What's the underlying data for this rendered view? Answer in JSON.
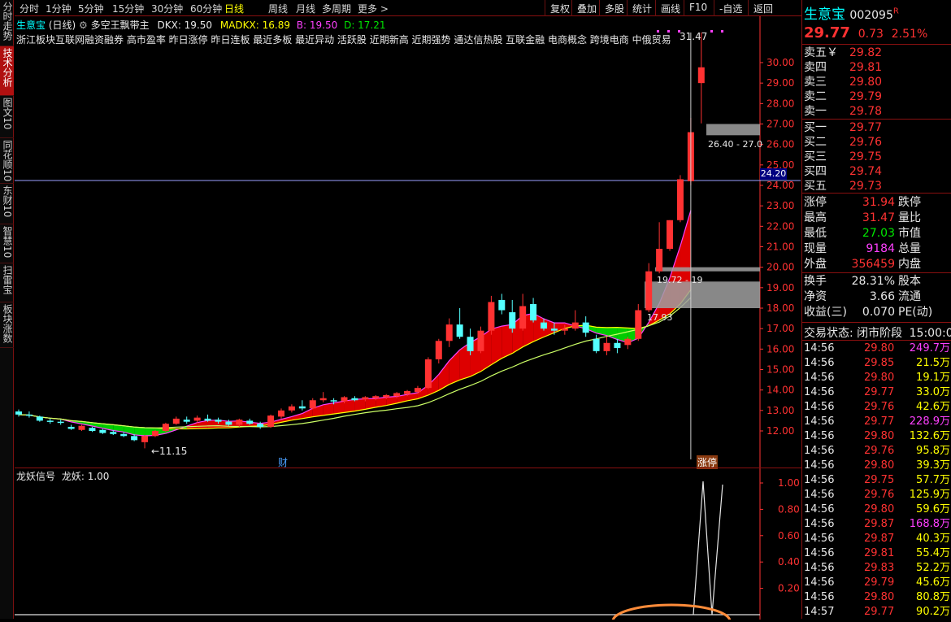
{
  "left_tabs": [
    {
      "label": "分时走势",
      "active": false
    },
    {
      "label": "技术分析",
      "active": true
    },
    {
      "label": "图文10",
      "active": false
    },
    {
      "label": "同花顺10",
      "active": false
    },
    {
      "label": "东财10",
      "active": false
    },
    {
      "label": "智慧10",
      "active": false
    },
    {
      "label": "扫雷宝",
      "active": false
    },
    {
      "label": "板块涨数",
      "active": false
    }
  ],
  "toolbar": {
    "periods": [
      "分时",
      "1分钟",
      "5分钟",
      "15分钟",
      "30分钟",
      "60分钟",
      "日线",
      "周线",
      "月线",
      "多周期",
      "更多 >"
    ],
    "active_period": "日线",
    "right_buttons": [
      "复权",
      "叠加",
      "多股",
      "统计",
      "画线",
      "F10",
      "-自选",
      "返回"
    ]
  },
  "chart_header": {
    "stock": "生意宝",
    "period": "(日线)",
    "indicator": "多空王飘带主",
    "dkx": "DKX: 19.50",
    "madkx": "MADKX: 16.89",
    "b": "B: 19.50",
    "d": "D: 17.21",
    "concepts": "浙江板块互联网融资融券 高市盈率 昨日涨停 昨日连板 最近多板 最近异动 活跃股 近期新高 近期强势 通达信热股 互联金融 电商概念 跨境电商 中俄贸易"
  },
  "chart_labels": {
    "high_marker": "31.47",
    "low_marker": "←11.15",
    "box1_label": "26.40 - 27.0",
    "current_price_tag": "24.20",
    "box2_label": "19.72 - 19",
    "box3_label": "17.93",
    "fin_marker": "财",
    "zt_marker": "涨停"
  },
  "colors": {
    "up": "#ff3232",
    "down": "#54ffff",
    "ribbon_bull": "#dd0000",
    "ribbon_bear": "#00cc00",
    "axis": "#ff3232"
  },
  "price_axis": [
    "30.00",
    "29.00",
    "28.00",
    "27.00",
    "26.00",
    "25.00",
    "24.00",
    "23.00",
    "22.00",
    "21.00",
    "20.00",
    "19.00",
    "18.00",
    "17.00",
    "16.00",
    "15.00",
    "14.00",
    "13.00",
    "12.00"
  ],
  "indicator_panel": {
    "name": "龙妖信号",
    "value": "龙妖: 1.00",
    "axis": [
      "1.00",
      "0.80",
      "0.60",
      "0.40",
      "0.20"
    ]
  },
  "chart_data": {
    "type": "candlestick",
    "ohlc": [
      [
        12.95,
        13.05,
        12.7,
        12.8
      ],
      [
        12.8,
        12.95,
        12.65,
        12.75
      ],
      [
        12.7,
        12.75,
        12.45,
        12.5
      ],
      [
        12.5,
        12.6,
        12.35,
        12.45
      ],
      [
        12.45,
        12.55,
        12.3,
        12.4
      ],
      [
        12.2,
        12.3,
        12.05,
        12.1
      ],
      [
        12.05,
        12.3,
        12.0,
        12.25
      ],
      [
        12.15,
        12.2,
        11.95,
        12.0
      ],
      [
        12.05,
        12.1,
        11.85,
        11.9
      ],
      [
        11.95,
        12.05,
        11.8,
        11.85
      ],
      [
        11.85,
        11.95,
        11.7,
        11.75
      ],
      [
        11.75,
        11.85,
        11.5,
        11.55
      ],
      [
        11.45,
        11.8,
        11.15,
        11.75
      ],
      [
        11.75,
        12.05,
        11.7,
        12.0
      ],
      [
        12.0,
        12.4,
        11.95,
        12.35
      ],
      [
        12.35,
        12.7,
        12.3,
        12.6
      ],
      [
        12.55,
        12.7,
        12.35,
        12.45
      ],
      [
        12.5,
        12.75,
        12.4,
        12.65
      ],
      [
        12.6,
        12.8,
        12.45,
        12.5
      ],
      [
        12.55,
        12.65,
        12.35,
        12.45
      ],
      [
        12.45,
        12.55,
        12.25,
        12.3
      ],
      [
        12.3,
        12.6,
        12.2,
        12.55
      ],
      [
        12.5,
        12.6,
        12.3,
        12.35
      ],
      [
        12.35,
        12.45,
        12.1,
        12.2
      ],
      [
        12.2,
        12.8,
        12.15,
        12.75
      ],
      [
        12.7,
        13.1,
        12.6,
        13.0
      ],
      [
        13.0,
        13.3,
        12.9,
        13.2
      ],
      [
        13.2,
        13.5,
        13.0,
        13.1
      ],
      [
        13.1,
        13.6,
        13.05,
        13.5
      ],
      [
        13.5,
        13.9,
        13.4,
        13.6
      ],
      [
        13.5,
        13.6,
        13.3,
        13.45
      ],
      [
        13.45,
        13.7,
        13.35,
        13.65
      ],
      [
        13.6,
        13.7,
        13.45,
        13.5
      ],
      [
        13.55,
        13.7,
        13.45,
        13.65
      ],
      [
        13.6,
        13.75,
        13.5,
        13.7
      ],
      [
        13.65,
        13.8,
        13.55,
        13.75
      ],
      [
        13.7,
        13.9,
        13.6,
        13.85
      ],
      [
        13.8,
        14.0,
        13.7,
        13.95
      ],
      [
        13.9,
        14.2,
        13.8,
        14.1
      ],
      [
        14.1,
        15.6,
        14.05,
        15.5
      ],
      [
        15.5,
        16.5,
        15.3,
        16.4
      ],
      [
        16.4,
        17.5,
        16.1,
        17.2
      ],
      [
        17.2,
        18.0,
        16.5,
        16.6
      ],
      [
        16.6,
        17.0,
        15.7,
        15.9
      ],
      [
        15.9,
        17.1,
        15.8,
        16.9
      ],
      [
        16.9,
        18.6,
        16.7,
        18.3
      ],
      [
        18.4,
        18.7,
        17.7,
        17.9
      ],
      [
        17.8,
        18.4,
        16.8,
        17.0
      ],
      [
        17.0,
        18.7,
        16.9,
        18.1
      ],
      [
        18.2,
        18.5,
        17.3,
        17.4
      ],
      [
        17.3,
        17.5,
        16.9,
        17.0
      ],
      [
        17.0,
        17.3,
        16.7,
        16.9
      ],
      [
        16.9,
        17.2,
        16.7,
        17.0
      ],
      [
        17.0,
        17.9,
        16.9,
        17.3
      ],
      [
        17.3,
        17.6,
        16.6,
        16.8
      ],
      [
        16.5,
        16.7,
        15.8,
        15.9
      ],
      [
        15.9,
        16.6,
        15.7,
        16.3
      ],
      [
        16.3,
        16.5,
        15.8,
        16.05
      ],
      [
        16.2,
        16.6,
        16.0,
        16.5
      ],
      [
        16.5,
        18.2,
        16.4,
        17.9
      ],
      [
        17.9,
        20.2,
        17.8,
        19.8
      ],
      [
        19.8,
        22.2,
        19.7,
        20.9
      ],
      [
        20.9,
        22.3,
        20.8,
        22.3
      ],
      [
        22.3,
        24.5,
        22.2,
        24.3
      ],
      [
        24.2,
        27.3,
        24.0,
        26.6
      ],
      [
        29.0,
        31.47,
        27.03,
        29.77
      ]
    ],
    "xlabel": "",
    "ylabel": "",
    "ylim": [
      11,
      31.5
    ]
  },
  "quote": {
    "name": "生意宝",
    "code": "002095",
    "flag": "R",
    "price": "29.77",
    "change": "0.73",
    "pct": "2.51%",
    "sells": [
      {
        "label": "卖五￥",
        "price": "29.82"
      },
      {
        "label": "卖四",
        "price": "29.81"
      },
      {
        "label": "卖三",
        "price": "29.80"
      },
      {
        "label": "卖二",
        "price": "29.79"
      },
      {
        "label": "卖一",
        "price": "29.78"
      }
    ],
    "buys": [
      {
        "label": "买一",
        "price": "29.77"
      },
      {
        "label": "买二",
        "price": "29.76"
      },
      {
        "label": "买三",
        "price": "29.75"
      },
      {
        "label": "买四",
        "price": "29.74"
      },
      {
        "label": "买五",
        "price": "29.73"
      }
    ],
    "stats": [
      {
        "l": "涨停",
        "v": "31.94",
        "r": "跌停",
        "c": "red"
      },
      {
        "l": "最高",
        "v": "31.47",
        "r": "量比",
        "c": "red"
      },
      {
        "l": "最低",
        "v": "27.03",
        "r": "市值",
        "c": "green"
      },
      {
        "l": "现量",
        "v": "9184",
        "r": "总量",
        "c": "mag"
      },
      {
        "l": "外盘",
        "v": "356459",
        "r": "内盘",
        "c": "red"
      }
    ],
    "stats2": [
      {
        "l": "换手",
        "v": "28.31%",
        "r": "股本"
      },
      {
        "l": "净资",
        "v": "3.66",
        "r": "流通"
      },
      {
        "l": "收益(三)",
        "v": "0.070",
        "r": "PE(动)"
      }
    ],
    "trade_status_label": "交易状态:",
    "trade_status": "闭市阶段",
    "trade_time": "15:00:0"
  },
  "ticks": [
    {
      "t": "14:56",
      "p": "29.80",
      "v": "249.7万",
      "vc": "mag"
    },
    {
      "t": "14:56",
      "p": "29.85",
      "v": "21.5万",
      "vc": "yellow"
    },
    {
      "t": "14:56",
      "p": "29.80",
      "v": "19.1万",
      "vc": "yellow"
    },
    {
      "t": "14:56",
      "p": "29.77",
      "v": "33.0万",
      "vc": "yellow"
    },
    {
      "t": "14:56",
      "p": "29.76",
      "v": "42.6万",
      "vc": "yellow"
    },
    {
      "t": "14:56",
      "p": "29.77",
      "v": "228.9万",
      "vc": "mag"
    },
    {
      "t": "14:56",
      "p": "29.80",
      "v": "132.6万",
      "vc": "yellow"
    },
    {
      "t": "14:56",
      "p": "29.76",
      "v": "95.8万",
      "vc": "yellow"
    },
    {
      "t": "14:56",
      "p": "29.80",
      "v": "39.3万",
      "vc": "yellow"
    },
    {
      "t": "14:56",
      "p": "29.75",
      "v": "57.7万",
      "vc": "yellow"
    },
    {
      "t": "14:56",
      "p": "29.76",
      "v": "125.9万",
      "vc": "yellow"
    },
    {
      "t": "14:56",
      "p": "29.80",
      "v": "59.6万",
      "vc": "yellow"
    },
    {
      "t": "14:56",
      "p": "29.87",
      "v": "168.8万",
      "vc": "mag"
    },
    {
      "t": "14:56",
      "p": "29.87",
      "v": "40.3万",
      "vc": "yellow"
    },
    {
      "t": "14:56",
      "p": "29.81",
      "v": "55.4万",
      "vc": "yellow"
    },
    {
      "t": "14:56",
      "p": "29.83",
      "v": "52.2万",
      "vc": "yellow"
    },
    {
      "t": "14:56",
      "p": "29.79",
      "v": "45.6万",
      "vc": "yellow"
    },
    {
      "t": "14:56",
      "p": "29.80",
      "v": "80.8万",
      "vc": "yellow"
    },
    {
      "t": "14:57",
      "p": "29.77",
      "v": "90.2万",
      "vc": "yellow"
    }
  ]
}
